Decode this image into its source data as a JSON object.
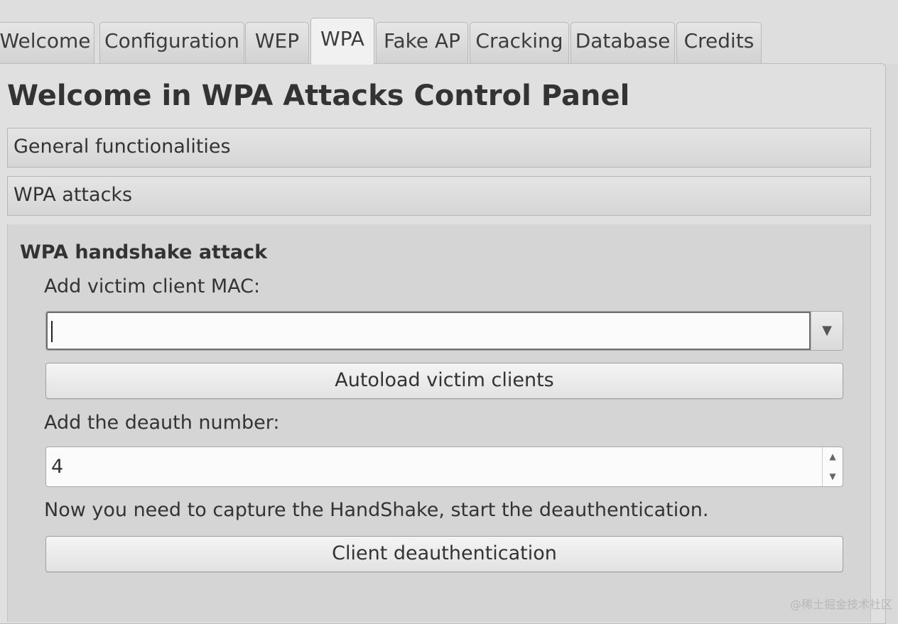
{
  "tabs": [
    {
      "label": "Welcome"
    },
    {
      "label": "Configuration"
    },
    {
      "label": "WEP"
    },
    {
      "label": "WPA"
    },
    {
      "label": "Fake AP"
    },
    {
      "label": "Cracking"
    },
    {
      "label": "Database"
    },
    {
      "label": "Credits"
    }
  ],
  "active_tab": "WPA",
  "page": {
    "title": "Welcome in WPA Attacks Control Panel"
  },
  "sections": {
    "general": "General functionalities",
    "wpa_attacks": "WPA attacks"
  },
  "handshake": {
    "group_title": "WPA handshake attack",
    "mac_label": "Add victim client MAC:",
    "mac_value": "",
    "mac_arrow": "▼",
    "autoload_button": "Autoload victim clients",
    "deauth_label": "Add the deauth number:",
    "deauth_value": "4",
    "spin_up": "▲",
    "spin_down": "▼",
    "capture_note": "Now you need to capture the HandShake, start the deauthentication.",
    "deauth_button": "Client deauthentication"
  },
  "watermark": "@稀土掘金技术社区"
}
